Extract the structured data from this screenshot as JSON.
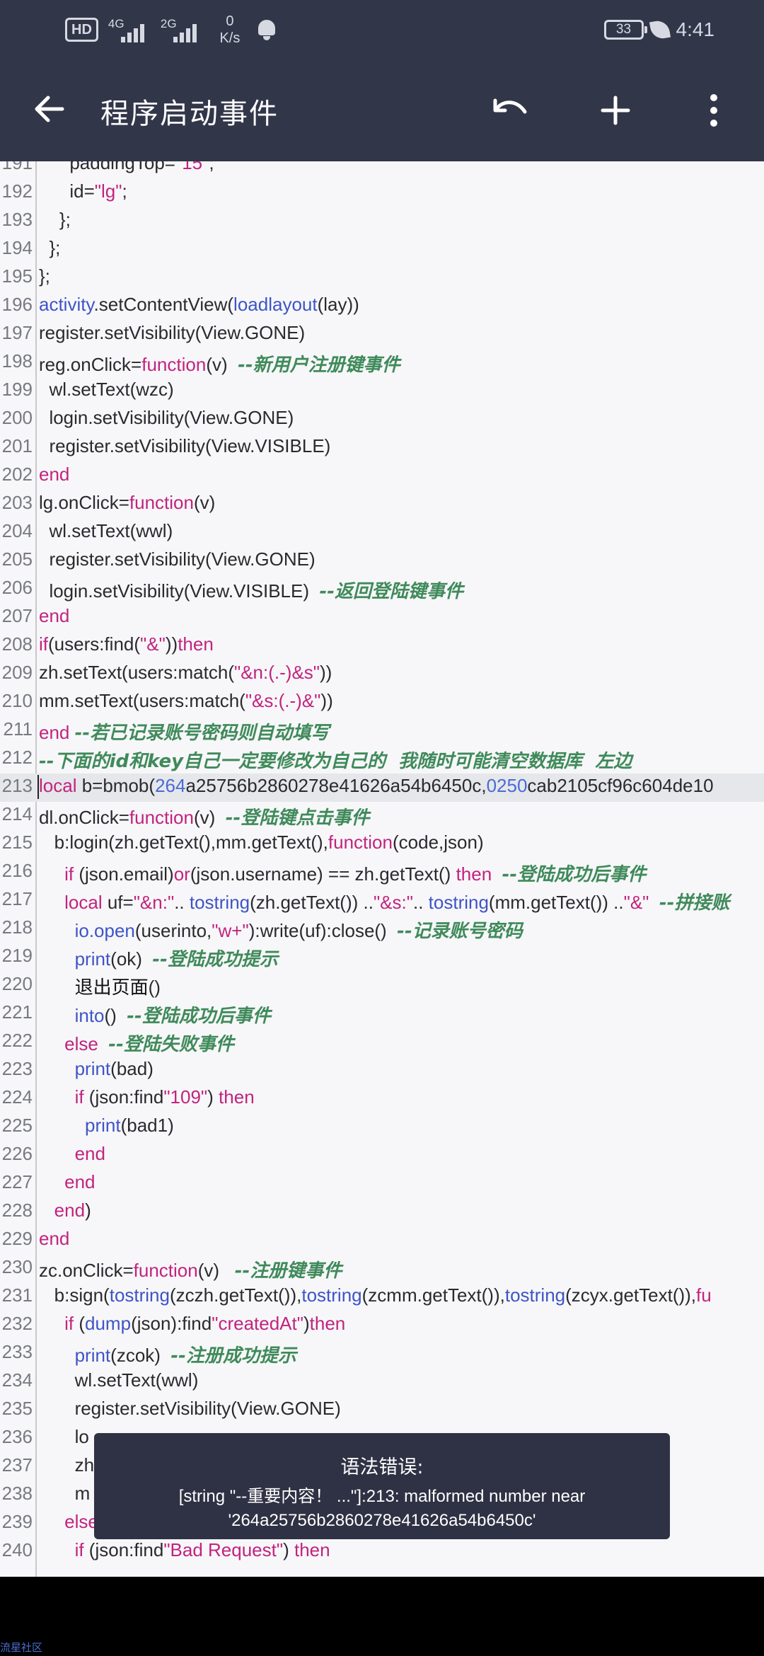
{
  "status_bar": {
    "hd": "HD",
    "net1": "4G",
    "net2": "2G",
    "speed_value": "0",
    "speed_unit": "K/s",
    "battery": "33",
    "time": "4:41"
  },
  "app_bar": {
    "title": "程序启动事件",
    "icons": [
      "back-arrow-icon",
      "undo-icon",
      "add-icon",
      "more-vert-icon"
    ]
  },
  "editor": {
    "current_line": "213",
    "lines": [
      {
        "n": "191",
        "segs": [
          [
            "",
            "      paddingTop="
          ],
          [
            "str",
            "\"15\""
          ],
          [
            "",
            ";"
          ]
        ]
      },
      {
        "n": "192",
        "segs": [
          [
            "",
            "      id="
          ],
          [
            "str",
            "\"lg\""
          ],
          [
            "",
            ";"
          ]
        ]
      },
      {
        "n": "193",
        "segs": [
          [
            "",
            "    };"
          ]
        ]
      },
      {
        "n": "194",
        "segs": [
          [
            "",
            "  };"
          ]
        ]
      },
      {
        "n": "195",
        "segs": [
          [
            "",
            "};"
          ]
        ]
      },
      {
        "n": "196",
        "segs": [
          [
            "bi",
            "activity"
          ],
          [
            "",
            ".setContentView("
          ],
          [
            "bi",
            "loadlayout"
          ],
          [
            "",
            "(lay))"
          ]
        ]
      },
      {
        "n": "197",
        "segs": [
          [
            "",
            "register.setVisibility(View.GONE)"
          ]
        ]
      },
      {
        "n": "198",
        "segs": [
          [
            "",
            "reg.onClick="
          ],
          [
            "kw",
            "function"
          ],
          [
            "",
            "(v)  "
          ],
          [
            "cm",
            "--新用户注册键事件"
          ]
        ]
      },
      {
        "n": "199",
        "segs": [
          [
            "",
            "  wl.setText(wzc)"
          ]
        ]
      },
      {
        "n": "200",
        "segs": [
          [
            "",
            "  login.setVisibility(View.GONE)"
          ]
        ]
      },
      {
        "n": "201",
        "segs": [
          [
            "",
            "  register.setVisibility(View.VISIBLE)"
          ]
        ]
      },
      {
        "n": "202",
        "segs": [
          [
            "kw",
            "end"
          ]
        ]
      },
      {
        "n": "203",
        "segs": [
          [
            "",
            "lg.onClick="
          ],
          [
            "kw",
            "function"
          ],
          [
            "",
            "(v)"
          ]
        ]
      },
      {
        "n": "204",
        "segs": [
          [
            "",
            "  wl.setText(wwl)"
          ]
        ]
      },
      {
        "n": "205",
        "segs": [
          [
            "",
            "  register.setVisibility(View.GONE)"
          ]
        ]
      },
      {
        "n": "206",
        "segs": [
          [
            "",
            "  login.setVisibility(View.VISIBLE)  "
          ],
          [
            "cm",
            "--返回登陆键事件"
          ]
        ]
      },
      {
        "n": "207",
        "segs": [
          [
            "kw",
            "end"
          ]
        ]
      },
      {
        "n": "208",
        "segs": [
          [
            "kw",
            "if"
          ],
          [
            "",
            "(users:find("
          ],
          [
            "str",
            "\"&\""
          ],
          [
            "",
            "))"
          ],
          [
            "kw",
            "then"
          ]
        ]
      },
      {
        "n": "209",
        "segs": [
          [
            "",
            "zh.setText(users:match("
          ],
          [
            "str",
            "\"&n:(.-)&s\""
          ],
          [
            "",
            "))"
          ]
        ]
      },
      {
        "n": "210",
        "segs": [
          [
            "",
            "mm.setText(users:match("
          ],
          [
            "str",
            "\"&s:(.-)&\""
          ],
          [
            "",
            "))"
          ]
        ]
      },
      {
        "n": "211",
        "segs": [
          [
            "kw",
            "end"
          ],
          [
            "",
            " "
          ],
          [
            "cm",
            "--若已记录账号密码则自动填写"
          ]
        ]
      },
      {
        "n": "212",
        "segs": [
          [
            "cm",
            "--下面的id和key自己一定要修改为自己的  我随时可能清空数据库  左边"
          ]
        ]
      },
      {
        "n": "213",
        "segs": [
          [
            "kw",
            "local"
          ],
          [
            "",
            " b=bmob("
          ],
          [
            "num",
            "264"
          ],
          [
            "",
            "a25756b2860278e41626a54b6450c,"
          ],
          [
            "num",
            "0250"
          ],
          [
            "",
            "cab2105cf96c604de10"
          ]
        ]
      },
      {
        "n": "214",
        "segs": [
          [
            "",
            "dl.onClick="
          ],
          [
            "kw",
            "function"
          ],
          [
            "",
            "(v)  "
          ],
          [
            "cm",
            "--登陆键点击事件"
          ]
        ]
      },
      {
        "n": "215",
        "segs": [
          [
            "",
            "   b:login(zh.getText(),mm.getText(),"
          ],
          [
            "kw",
            "function"
          ],
          [
            "",
            "(code,json)"
          ]
        ]
      },
      {
        "n": "216",
        "segs": [
          [
            "",
            "     "
          ],
          [
            "kw",
            "if"
          ],
          [
            "",
            " (json.email)"
          ],
          [
            "kw",
            "or"
          ],
          [
            "",
            "(json.username) == zh.getText() "
          ],
          [
            "kw",
            "then"
          ],
          [
            "",
            "  "
          ],
          [
            "cm",
            "--登陆成功后事件"
          ]
        ]
      },
      {
        "n": "217",
        "segs": [
          [
            "",
            "     "
          ],
          [
            "kw",
            "local"
          ],
          [
            "",
            " uf="
          ],
          [
            "str",
            "\"&n:\""
          ],
          [
            "",
            ".. "
          ],
          [
            "bi",
            "tostring"
          ],
          [
            "",
            "(zh.getText()) .."
          ],
          [
            "str",
            "\"&s:\""
          ],
          [
            "",
            ".. "
          ],
          [
            "bi",
            "tostring"
          ],
          [
            "",
            "(mm.getText()) .."
          ],
          [
            "str",
            "\"&\""
          ],
          [
            "",
            "  "
          ],
          [
            "cm",
            "--拼接账"
          ]
        ]
      },
      {
        "n": "218",
        "segs": [
          [
            "",
            "       "
          ],
          [
            "bi",
            "io.open"
          ],
          [
            "",
            "(userinto,"
          ],
          [
            "str",
            "\"w+\""
          ],
          [
            "",
            "):write(uf):close()  "
          ],
          [
            "cm",
            "--记录账号密码"
          ]
        ]
      },
      {
        "n": "219",
        "segs": [
          [
            "",
            "       "
          ],
          [
            "bi",
            "print"
          ],
          [
            "",
            "(ok)  "
          ],
          [
            "cm",
            "--登陆成功提示"
          ]
        ]
      },
      {
        "n": "220",
        "segs": [
          [
            "",
            "       "
          ],
          [
            "ch",
            "退出页面"
          ],
          [
            "",
            "()"
          ]
        ]
      },
      {
        "n": "221",
        "segs": [
          [
            "",
            "       "
          ],
          [
            "bi",
            "into"
          ],
          [
            "",
            "()  "
          ],
          [
            "cm",
            "--登陆成功后事件"
          ]
        ]
      },
      {
        "n": "222",
        "segs": [
          [
            "",
            "     "
          ],
          [
            "kw",
            "else"
          ],
          [
            "",
            "  "
          ],
          [
            "cm",
            "--登陆失败事件"
          ]
        ]
      },
      {
        "n": "223",
        "segs": [
          [
            "",
            "       "
          ],
          [
            "bi",
            "print"
          ],
          [
            "",
            "(bad)"
          ]
        ]
      },
      {
        "n": "224",
        "segs": [
          [
            "",
            "       "
          ],
          [
            "kw",
            "if"
          ],
          [
            "",
            " (json:find"
          ],
          [
            "str",
            "\"109\""
          ],
          [
            "",
            ") "
          ],
          [
            "kw",
            "then"
          ]
        ]
      },
      {
        "n": "225",
        "segs": [
          [
            "",
            "         "
          ],
          [
            "bi",
            "print"
          ],
          [
            "",
            "(bad1)"
          ]
        ]
      },
      {
        "n": "226",
        "segs": [
          [
            "",
            "       "
          ],
          [
            "kw",
            "end"
          ]
        ]
      },
      {
        "n": "227",
        "segs": [
          [
            "",
            "     "
          ],
          [
            "kw",
            "end"
          ]
        ]
      },
      {
        "n": "228",
        "segs": [
          [
            "",
            "   "
          ],
          [
            "kw",
            "end"
          ],
          [
            "",
            ")"
          ]
        ]
      },
      {
        "n": "229",
        "segs": [
          [
            "kw",
            "end"
          ]
        ]
      },
      {
        "n": "230",
        "segs": [
          [
            "",
            "zc.onClick="
          ],
          [
            "kw",
            "function"
          ],
          [
            "",
            "(v)   "
          ],
          [
            "cm",
            "--注册键事件"
          ]
        ]
      },
      {
        "n": "231",
        "segs": [
          [
            "",
            "   b:sign("
          ],
          [
            "bi",
            "tostring"
          ],
          [
            "",
            "(zczh.getText()),"
          ],
          [
            "bi",
            "tostring"
          ],
          [
            "",
            "(zcmm.getText()),"
          ],
          [
            "bi",
            "tostring"
          ],
          [
            "",
            "(zcyx.getText()),"
          ],
          [
            "kw",
            "fu"
          ]
        ]
      },
      {
        "n": "232",
        "segs": [
          [
            "",
            "     "
          ],
          [
            "kw",
            "if"
          ],
          [
            "",
            " ("
          ],
          [
            "bi",
            "dump"
          ],
          [
            "",
            "(json):find"
          ],
          [
            "str",
            "\"createdAt\""
          ],
          [
            "",
            ")"
          ],
          [
            "kw",
            "then"
          ]
        ]
      },
      {
        "n": "233",
        "segs": [
          [
            "",
            "       "
          ],
          [
            "bi",
            "print"
          ],
          [
            "",
            "(zcok)  "
          ],
          [
            "cm",
            "--注册成功提示"
          ]
        ]
      },
      {
        "n": "234",
        "segs": [
          [
            "",
            "       wl.setText(wwl)"
          ]
        ]
      },
      {
        "n": "235",
        "segs": [
          [
            "",
            "       register.setVisibility(View.GONE)"
          ]
        ]
      },
      {
        "n": "236",
        "segs": [
          [
            "",
            "       lo"
          ]
        ]
      },
      {
        "n": "237",
        "segs": [
          [
            "",
            "       zh"
          ]
        ]
      },
      {
        "n": "238",
        "segs": [
          [
            "",
            "       m"
          ]
        ]
      },
      {
        "n": "239",
        "segs": [
          [
            "",
            "     "
          ],
          [
            "kw",
            "else"
          ]
        ]
      },
      {
        "n": "240",
        "segs": [
          [
            "",
            "       "
          ],
          [
            "kw",
            "if"
          ],
          [
            "",
            " (json:find"
          ],
          [
            "str",
            "\"Bad Request\""
          ],
          [
            "",
            ") "
          ],
          [
            "kw",
            "then"
          ]
        ]
      }
    ]
  },
  "toast": {
    "title": "语法错误:",
    "line1": "[string \"--重要内容！ ...\"]:213: malformed number near",
    "line2": "'264a25756b2860278e41626a54b6450c'"
  },
  "watermark": "流星社区",
  "colors": {
    "bar_bg": "#323649",
    "editor_bg": "#f7f7f9",
    "keyword": "#c2237f",
    "builtin": "#3e54c7",
    "comment": "#3f8a5a",
    "number": "#4a6bd4"
  }
}
